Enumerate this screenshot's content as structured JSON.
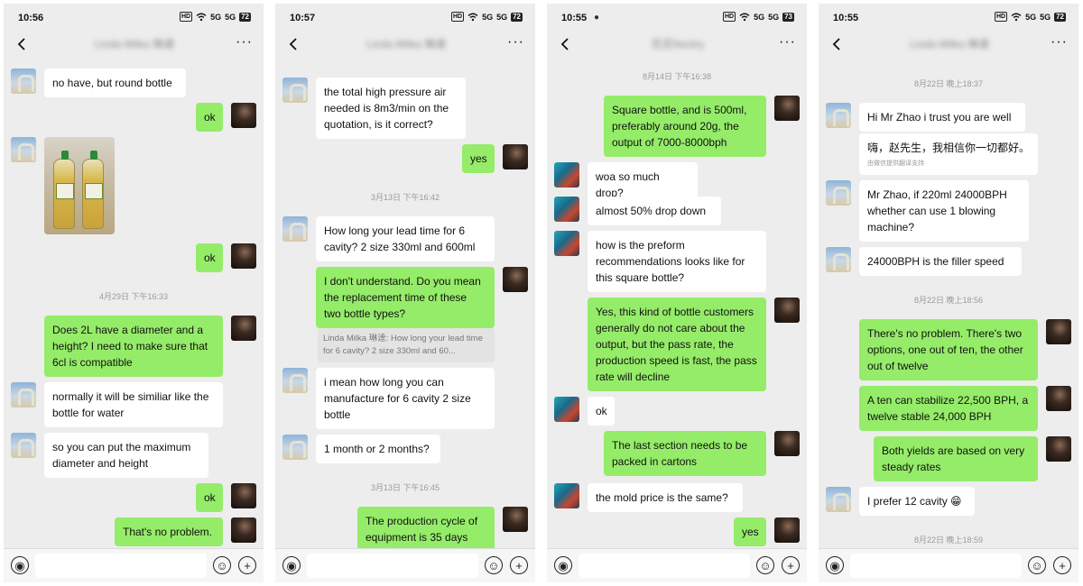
{
  "phones": [
    {
      "status": {
        "time": "10:56",
        "battery": "72",
        "signal1": "5G",
        "signal2": "5G"
      },
      "chat_title": "Linda Milka 琳達",
      "messages": [
        {
          "side": "left",
          "avatar": "arch",
          "text": "no have, but round bottle"
        },
        {
          "side": "right",
          "avatar": "dark",
          "text": "ok"
        },
        {
          "side": "left",
          "avatar": "arch",
          "image": "oil-bottles-photo"
        },
        {
          "side": "right",
          "avatar": "dark",
          "text": "ok"
        },
        {
          "timestamp": "4月29日 下午16:33"
        },
        {
          "side": "right",
          "avatar": "dark",
          "text": "Does 2L have a diameter and a height? I need to make sure that 6cl is compatible"
        },
        {
          "side": "left",
          "avatar": "arch",
          "text": "normally it will be similiar like the bottle for water"
        },
        {
          "side": "left",
          "avatar": "arch",
          "text": "so you can put the maximum diameter and height"
        },
        {
          "side": "right",
          "avatar": "dark",
          "text": "ok"
        },
        {
          "side": "right",
          "avatar": "dark",
          "text": "That's no problem."
        }
      ]
    },
    {
      "status": {
        "time": "10:57",
        "battery": "72",
        "signal1": "5G",
        "signal2": "5G"
      },
      "chat_title": "Linda Milka 琳達",
      "messages": [
        {
          "side": "left",
          "avatar": "arch",
          "text": "the total high pressure air needed is 8m3/min on the quotation, is it correct?"
        },
        {
          "side": "right",
          "avatar": "dark",
          "text": "yes"
        },
        {
          "timestamp": "3月13日 下午16:42"
        },
        {
          "side": "left",
          "avatar": "arch",
          "text": "How long your lead time for 6 cavity? 2 size 330ml and 600ml"
        },
        {
          "side": "right",
          "avatar": "dark",
          "text": "I don't understand. Do you mean the replacement time of these two bottle types?"
        },
        {
          "quote": "Linda Milka 琳達: How long your lead time for 6 cavity? 2 size 330ml and 60..."
        },
        {
          "side": "left",
          "avatar": "arch",
          "text": "i mean how long you can manufacture for 6 cavity 2 size bottle"
        },
        {
          "side": "left",
          "avatar": "arch",
          "text": "1 month or 2 months?"
        },
        {
          "timestamp": "3月13日 下午16:45"
        },
        {
          "side": "right",
          "avatar": "dark",
          "text": "The production cycle of equipment is 35 days"
        }
      ]
    },
    {
      "status": {
        "time": "10:55",
        "battery": "73",
        "signal1": "5G",
        "signal2": "5G"
      },
      "chat_title": "花花Nestry",
      "messages": [
        {
          "timestamp": "8月14日 下午16:38"
        },
        {
          "side": "right",
          "avatar": "dark",
          "text": "Square bottle, and is 500ml, preferably around 20g, the output of 7000-8000bph"
        },
        {
          "side": "left",
          "avatar": "cyan",
          "text": "woa so much drop?"
        },
        {
          "side": "left",
          "avatar": "cyan",
          "text": "almost 50% drop down"
        },
        {
          "side": "left",
          "avatar": "cyan",
          "text": "how is the preform recommendations looks like for this square bottle?"
        },
        {
          "side": "right",
          "avatar": "dark",
          "text": "Yes, this kind of bottle customers generally do not care about the output, but the pass rate, the production speed is fast, the pass rate will decline"
        },
        {
          "side": "left",
          "avatar": "cyan",
          "text": "ok"
        },
        {
          "side": "right",
          "avatar": "dark",
          "text": "The last section needs to be packed in cartons"
        },
        {
          "side": "left",
          "avatar": "cyan",
          "text": "the mold price is the same?"
        },
        {
          "side": "right",
          "avatar": "dark",
          "text": "yes"
        }
      ]
    },
    {
      "status": {
        "time": "10:55",
        "battery": "72",
        "signal1": "5G",
        "signal2": "5G"
      },
      "chat_title": "Linda Milka 琳達",
      "messages": [
        {
          "timestamp": "8月22日 晚上18:37"
        },
        {
          "side": "left",
          "avatar": "arch",
          "text": "Hi Mr Zhao i trust you are well"
        },
        {
          "translation": "嗨，赵先生，我相信你一切都好。",
          "translation_note": "由微信提供翻译支持"
        },
        {
          "side": "left",
          "avatar": "arch",
          "text": "Mr Zhao, if 220ml 24000BPH whether can use 1 blowing machine?"
        },
        {
          "side": "left",
          "avatar": "arch",
          "text": "24000BPH is the filler speed"
        },
        {
          "timestamp": "8月22日 晚上18:56"
        },
        {
          "side": "right",
          "avatar": "dark",
          "text": "There's no problem. There's two options, one out of ten, the other out of twelve"
        },
        {
          "side": "right",
          "avatar": "dark",
          "text": "A ten can stabilize 22,500 BPH, a twelve stable 24,000 BPH"
        },
        {
          "side": "right",
          "avatar": "dark",
          "text": "Both yields are based on very steady rates"
        },
        {
          "side": "left",
          "avatar": "arch",
          "text": "I prefer 12 cavity 😁"
        },
        {
          "timestamp": "8月22日 晚上18:59"
        }
      ]
    }
  ],
  "icons": {
    "back": "chevron-left-icon",
    "more": "more-dots-icon",
    "voice": "voice-icon",
    "emoji": "emoji-icon",
    "plus": "plus-icon",
    "more_glyph": "···",
    "emoji_glyph": "☺",
    "plus_glyph": "+",
    "voice_glyph": "◉"
  }
}
